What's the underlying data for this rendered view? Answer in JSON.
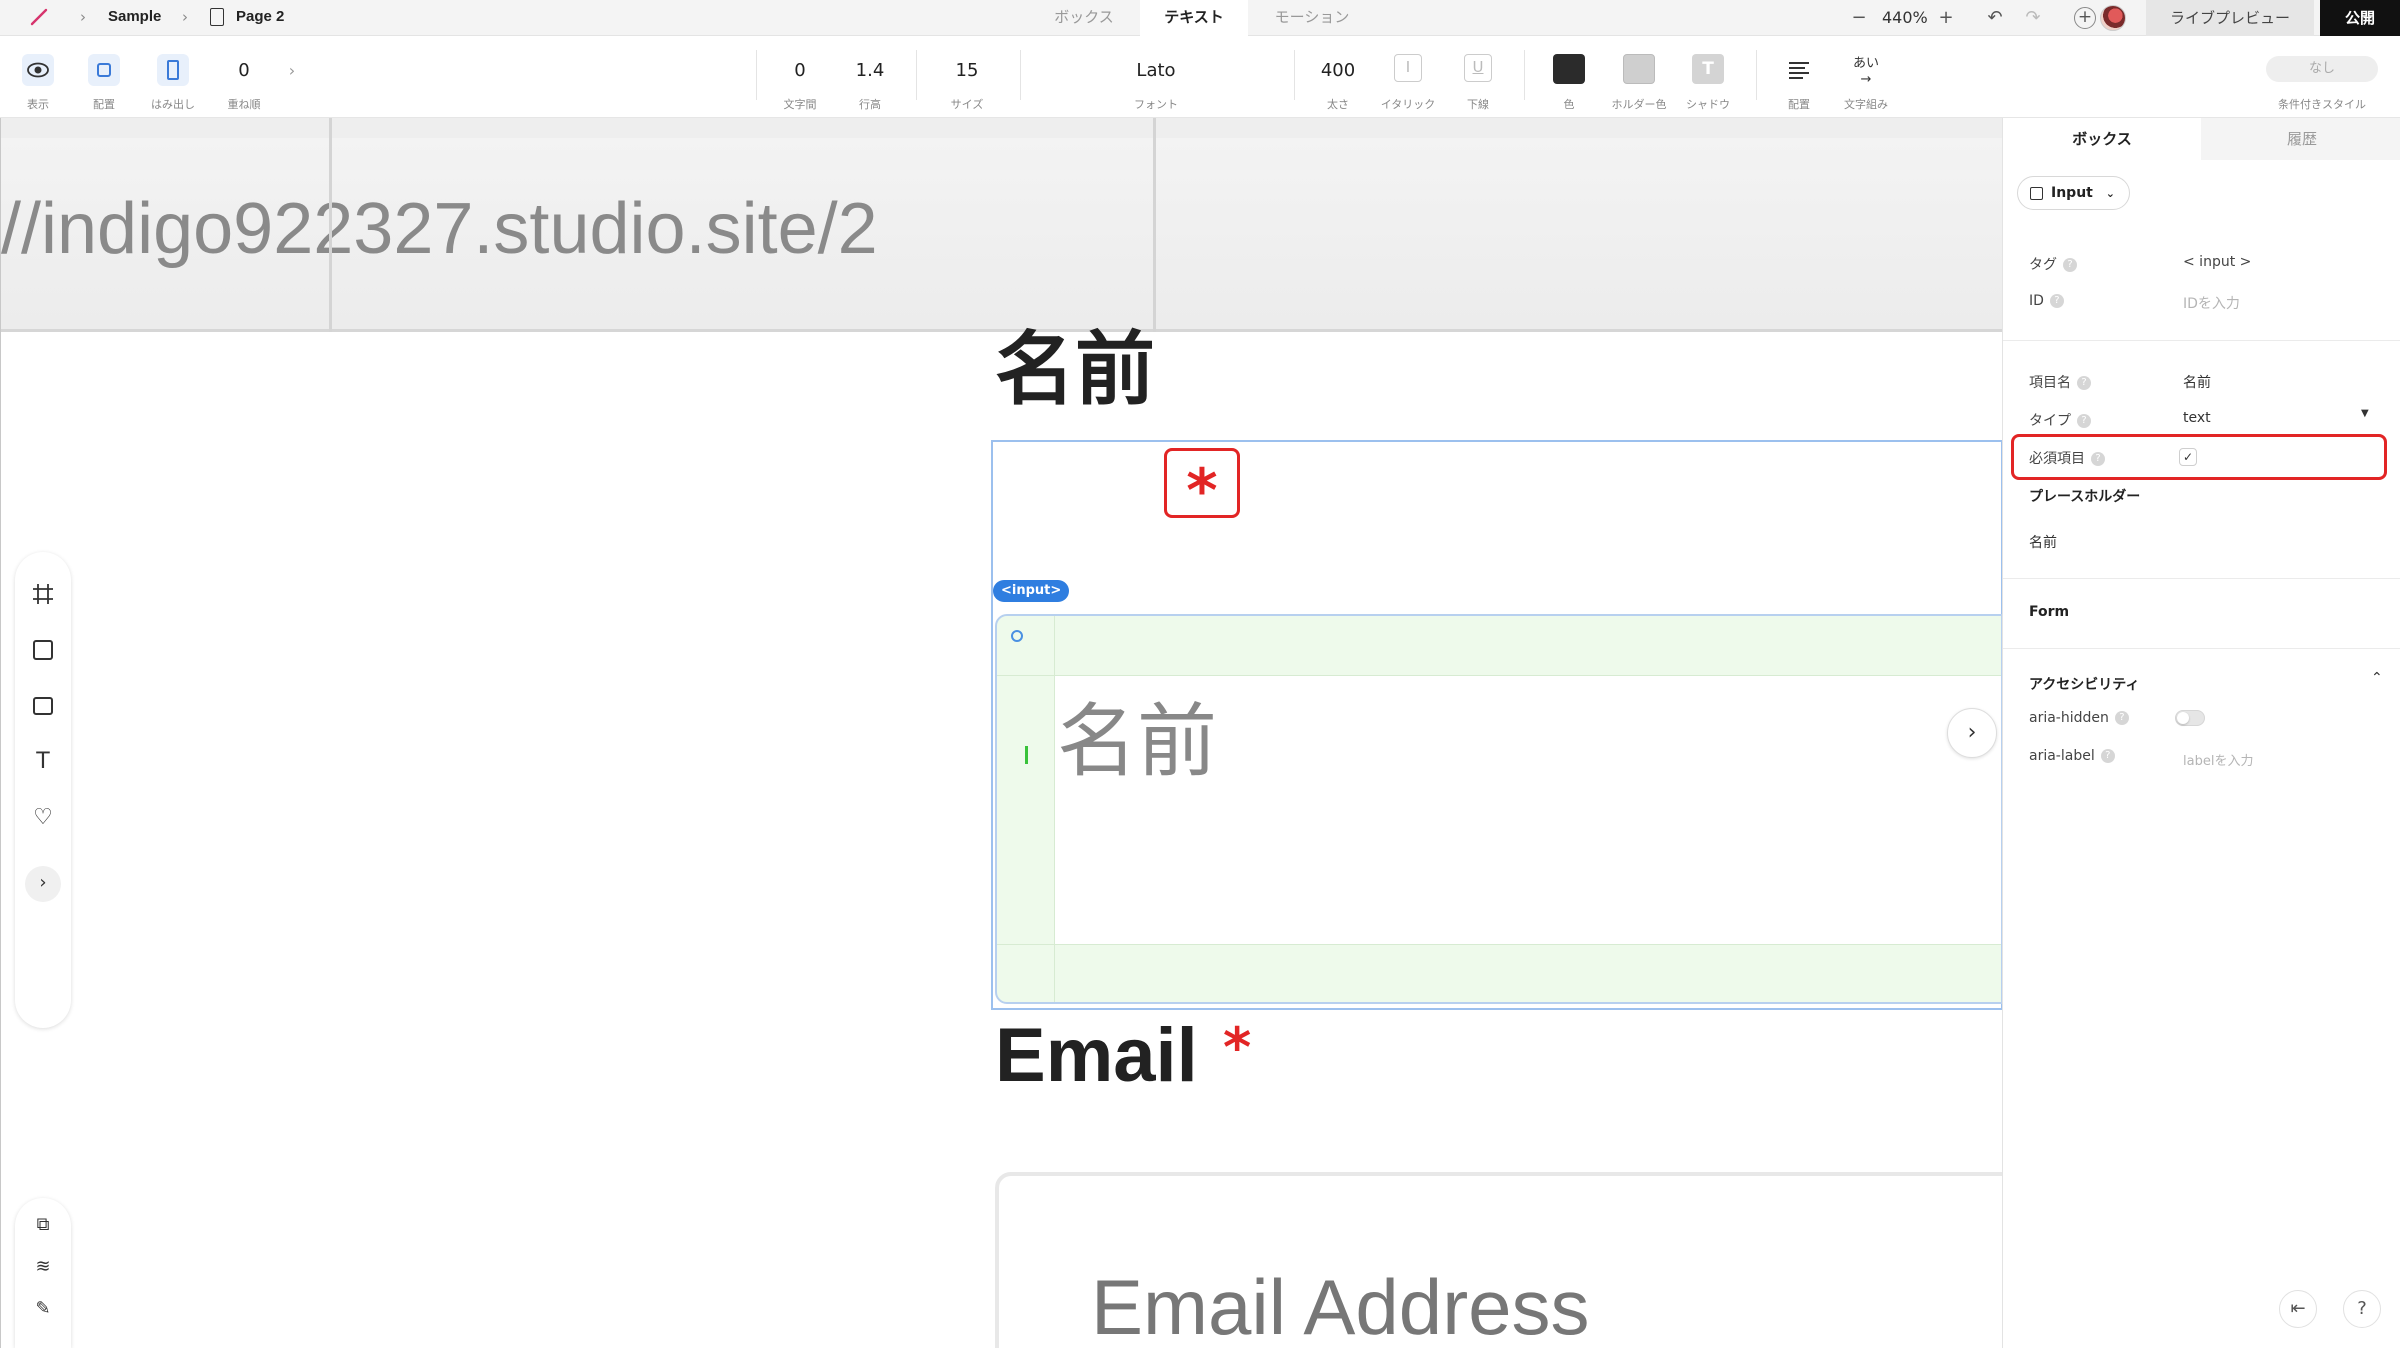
{
  "topbar": {
    "project": "Sample",
    "page": "Page 2",
    "modes": [
      "ボックス",
      "テキスト",
      "モーション"
    ],
    "active_mode": "テキスト",
    "zoom": "440%",
    "live_preview": "ライブプレビュー",
    "publish": "公開"
  },
  "toolbar": {
    "view": "表示",
    "layout": "配置",
    "overflow": "はみ出し",
    "z_value": "0",
    "z_label": "重ね順",
    "letter_spacing_value": "0",
    "letter_spacing_label": "文字間",
    "line_height_value": "1.4",
    "line_height_label": "行高",
    "size_value": "15",
    "size_label": "サイズ",
    "font_value": "Lato",
    "font_label": "フォント",
    "weight_value": "400",
    "weight_label": "太さ",
    "italic_label": "イタリック",
    "underline_label": "下線",
    "color_label": "色",
    "holder_color_label": "ホルダー色",
    "shadow_label": "シャドウ",
    "align_label": "配置",
    "typeset_label": "文字組み",
    "cond_value": "なし",
    "cond_label": "条件付きスタイル",
    "text_color": "#2b2b2b",
    "holder_color": "#cfcfcf"
  },
  "canvas": {
    "url_text": "//indigo922327.studio.site/2",
    "name_label": "名前",
    "required_star": "*",
    "input_tag": "<input>",
    "name_placeholder": "名前",
    "email_label": "Email",
    "email_star": "*",
    "email_placeholder": "Email Address"
  },
  "panel": {
    "tabs": [
      "ボックス",
      "履歴"
    ],
    "element_type": "Input",
    "tag_label": "タグ",
    "tag_value": "< input >",
    "id_label": "ID",
    "id_placeholder": "IDを入力",
    "field_name_label": "項目名",
    "field_name_value": "名前",
    "type_label": "タイプ",
    "type_value": "text",
    "required_label": "必須項目",
    "required_checked": "✓",
    "placeholder_label": "プレースホルダー",
    "placeholder_value": "名前",
    "form_label": "Form",
    "accessibility_label": "アクセシビリティ",
    "aria_hidden_label": "aria-hidden",
    "aria_label_label": "aria-label",
    "aria_label_placeholder": "labelを入力"
  },
  "colors": {
    "accent": "#2f7ee0",
    "highlight": "#e22525",
    "padding_fill": "#eefaeb"
  }
}
